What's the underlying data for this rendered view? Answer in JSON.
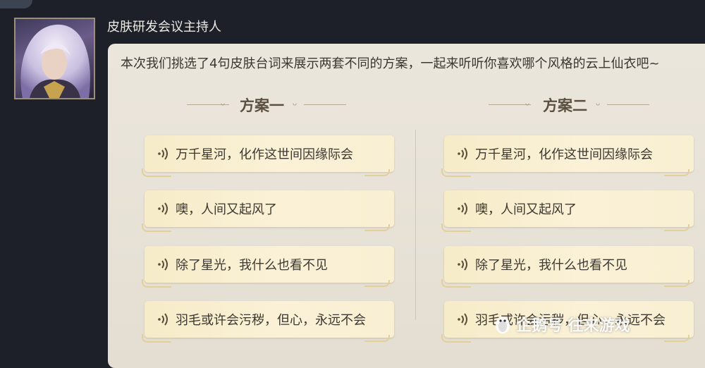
{
  "host": {
    "name": "皮肤研发会议主持人"
  },
  "intro": "本次我们挑选了4句皮肤台词来展示两套不同的方案，一起来听听你喜欢哪个风格的云上仙衣吧~",
  "plans": [
    {
      "title": "方案一",
      "lines": [
        "万千星河，化作这世间因缘际会",
        "噢，人间又起风了",
        "除了星光，我什么也看不见",
        "羽毛或许会污秽，但心，永远不会"
      ]
    },
    {
      "title": "方案二",
      "lines": [
        "万千星河，化作这世间因缘际会",
        "噢，人间又起风了",
        "除了星光，我什么也看不见",
        "羽毛或许会污秽，但心，永远不会"
      ]
    }
  ],
  "watermark": {
    "text": "企鹅号 往来游戏"
  },
  "icons": {
    "avatar": "character-portrait",
    "voice": "sound-wave-icon",
    "watermark": "penguin-icon"
  },
  "colors": {
    "panel": "#ebe6dc",
    "button": "#f8eecf",
    "background": "#1d2029"
  }
}
